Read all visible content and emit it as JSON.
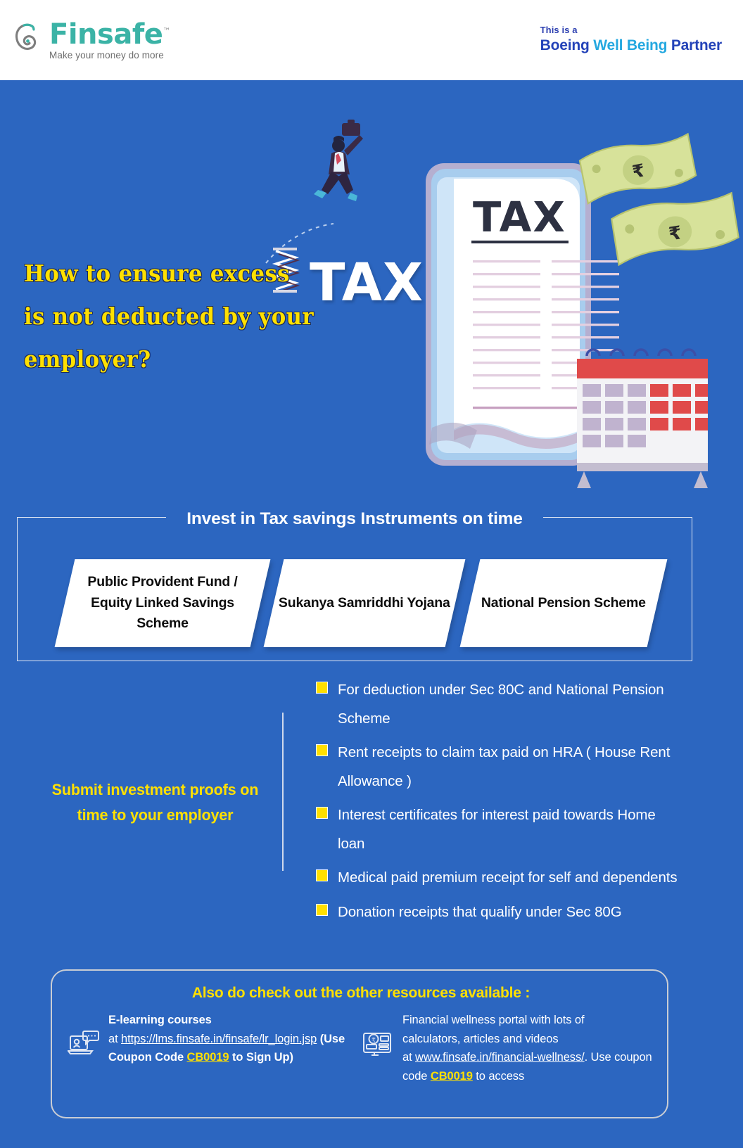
{
  "header": {
    "logo": {
      "icon": "finsafe-spiral-logo-icon",
      "name": "Finsafe",
      "trademark": "™",
      "tagline": "Make your money do more",
      "brand_color": "#3bb3a6"
    },
    "partner": {
      "small_line": "This is a",
      "word1": "Boeing",
      "word2": "Well Being",
      "word3": "Partner",
      "color_dark": "#2342b8",
      "color_light": "#24a8e0"
    }
  },
  "hero": {
    "headline_line1": "How to ensure excess",
    "headline_line2": "is not deducted by your employer?",
    "tax_word": "TAX",
    "headline_color": "#ffe000",
    "illustration": {
      "document_title": "TAX",
      "currency_symbol": "₹",
      "elements": [
        "running-businessman-icon",
        "spring-icon",
        "phone-tax-document-icon",
        "rupee-banknote-icon",
        "calendar-icon"
      ]
    }
  },
  "instruments": {
    "title": "Invest in Tax savings Instruments on time",
    "cards": [
      "Public Provident Fund / Equity Linked Savings Scheme",
      "Sukanya Samriddhi Yojana",
      "National Pension Scheme"
    ]
  },
  "proofs": {
    "heading": "Submit investment proofs on time to your employer",
    "heading_color": "#ffe000",
    "bullet_marker_color": "#ffe000",
    "items": [
      "For deduction under Sec 80C and National Pension Scheme",
      "Rent receipts to claim tax paid on HRA ( House Rent Allowance )",
      "Interest certificates for interest paid towards Home loan",
      "Medical paid premium receipt for self and dependents",
      "Donation receipts that qualify under Sec 80G"
    ]
  },
  "resources": {
    "title": "Also do check out the other resources available :",
    "title_color": "#ffe000",
    "items": [
      {
        "icon": "elearning-laptop-icon",
        "label": "E-learning  courses",
        "prefix": "at ",
        "url": "https://lms.finsafe.in/finsafe/lr_login.jsp",
        "mid": "  (Use Coupon Code ",
        "coupon": "CB0019",
        "suffix": " to Sign Up)"
      },
      {
        "icon": "financial-portal-monitor-icon",
        "line1": "Financial wellness portal with lots of",
        "line2": "calculators, articles and videos",
        "prefix": "at ",
        "url": "www.finsafe.in/financial-wellness/",
        "mid": ".  Use coupon code ",
        "coupon": "CB0019",
        "suffix": " to access"
      }
    ]
  },
  "theme": {
    "background": "#2c66c0",
    "accent_yellow": "#ffe000",
    "card_bg": "#ffffff"
  }
}
